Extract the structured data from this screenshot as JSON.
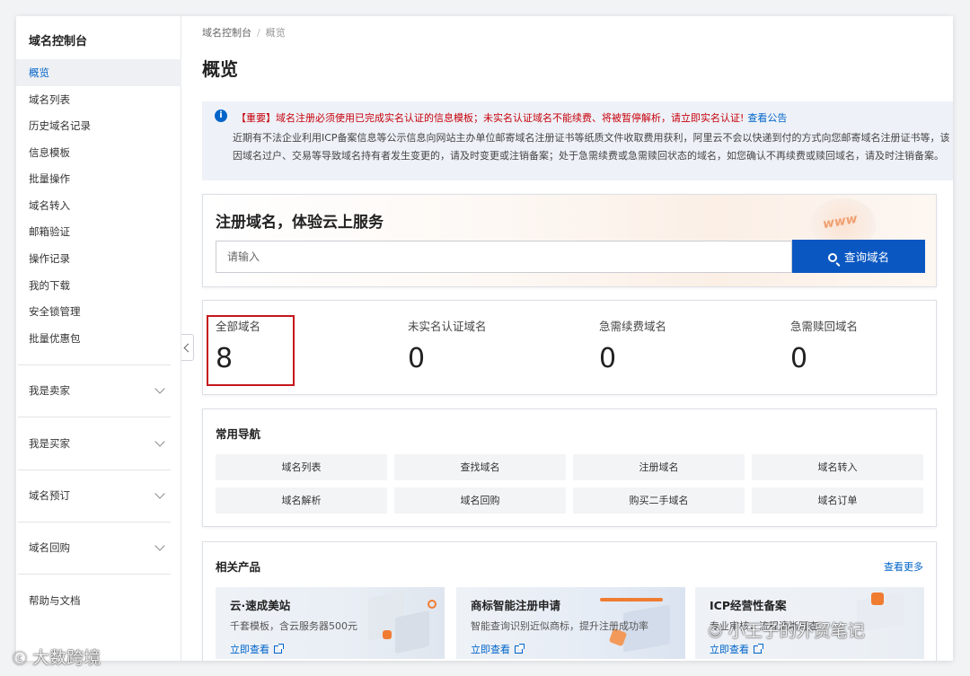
{
  "sidebar": {
    "title": "域名控制台",
    "items": [
      {
        "label": "概览",
        "active": true
      },
      {
        "label": "域名列表"
      },
      {
        "label": "历史域名记录"
      },
      {
        "label": "信息模板"
      },
      {
        "label": "批量操作"
      },
      {
        "label": "域名转入"
      },
      {
        "label": "邮箱验证"
      },
      {
        "label": "操作记录"
      },
      {
        "label": "我的下载"
      },
      {
        "label": "安全锁管理"
      },
      {
        "label": "批量优惠包"
      }
    ],
    "groups": [
      {
        "label": "我是卖家"
      },
      {
        "label": "我是买家"
      },
      {
        "label": "域名预订"
      },
      {
        "label": "域名回购"
      }
    ],
    "help": "帮助与文档"
  },
  "breadcrumb": {
    "root": "域名控制台",
    "separator": "/",
    "current": "概览"
  },
  "page_title": "概览",
  "notice": {
    "headline": "【重要】域名注册必须使用已完成实名认证的信息模板；未实名认证域名不能续费、将被暂停解析，请立即实名认证!",
    "link": "查看公告",
    "line2": "近期有不法企业利用ICP备案信息等公示信息向网站主办单位邮寄域名注册证书等纸质文件收取费用获利，阿里云不会以快递到付的方式向您邮寄域名注册证书等，该",
    "line3": "因域名过户、交易等导致域名持有者发生变更的，请及时变更或注销备案；处于急需续费或急需赎回状态的域名，如您确认不再续费或赎回域名，请及时注销备案。"
  },
  "register": {
    "headline": "注册域名，体验云上服务",
    "placeholder": "请输入",
    "button": "查询域名",
    "deco_text": "www"
  },
  "stats": [
    {
      "label": "全部域名",
      "value": "8"
    },
    {
      "label": "未实名认证域名",
      "value": "0"
    },
    {
      "label": "急需续费域名",
      "value": "0"
    },
    {
      "label": "急需赎回域名",
      "value": "0"
    }
  ],
  "nav": {
    "title": "常用导航",
    "items": [
      "域名列表",
      "查找域名",
      "注册域名",
      "域名转入",
      "域名解析",
      "域名回购",
      "购买二手域名",
      "域名订单"
    ]
  },
  "products": {
    "title": "相关产品",
    "more": "查看更多",
    "items": [
      {
        "title": "云·速成美站",
        "desc": "千套模板，含云服务器500元",
        "link": "立即查看"
      },
      {
        "title": "商标智能注册申请",
        "desc": "智能查询识别近似商标，提升注册成功率",
        "link": "立即查看"
      },
      {
        "title": "ICP经营性备案",
        "desc": "专业审核，流程清晰可查",
        "link": "立即查看"
      }
    ]
  },
  "watermarks": {
    "left": "大数跨境",
    "right": "小王子的外贸笔记"
  },
  "colors": {
    "primary": "#0a57c2",
    "link": "#0064c8",
    "alert": "#c7000b",
    "highlight": "#c4161c"
  }
}
